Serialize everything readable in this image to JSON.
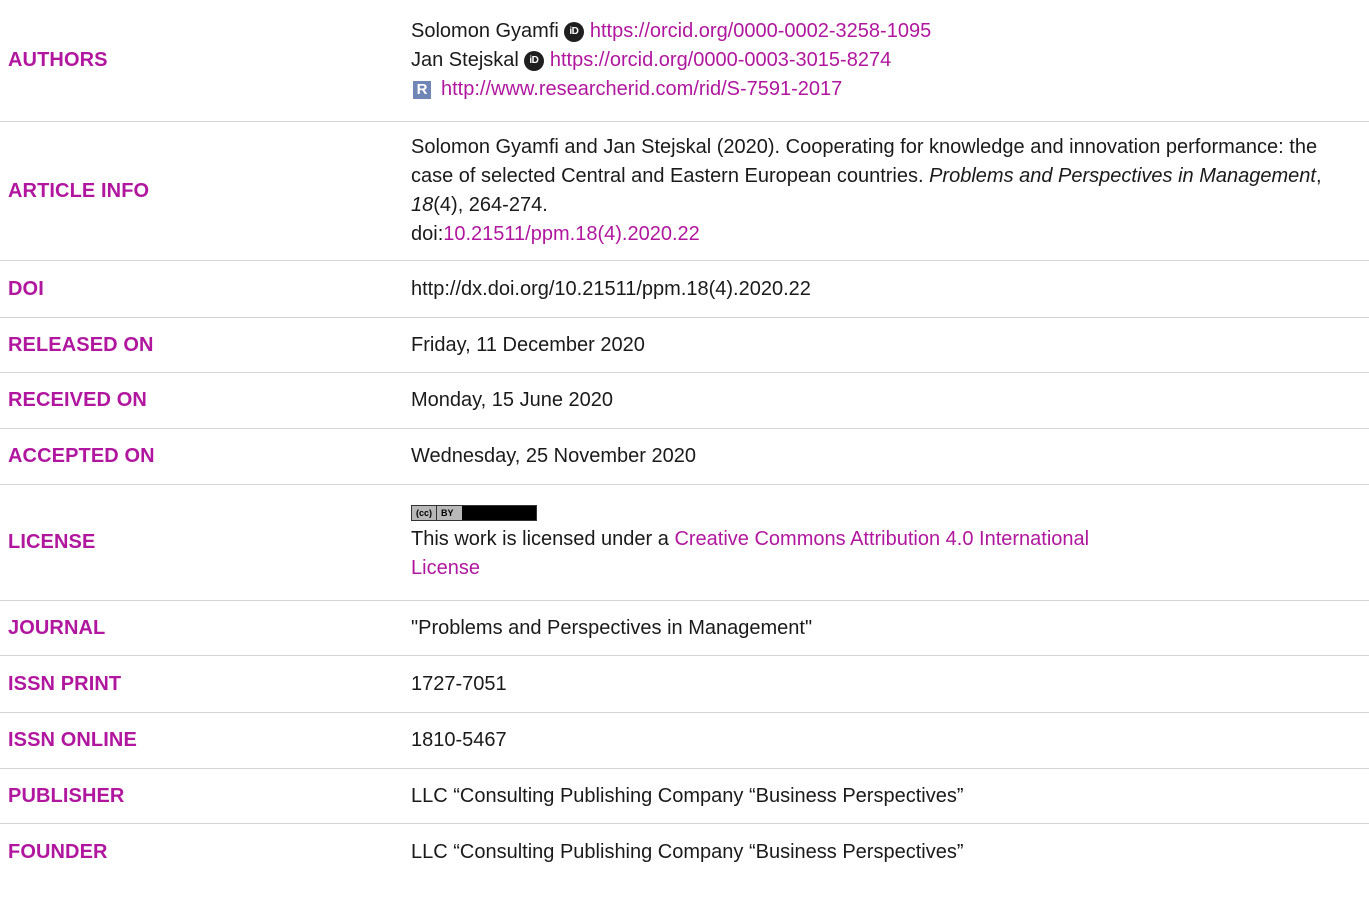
{
  "authors": {
    "label": "AUTHORS",
    "people": [
      {
        "name": "Solomon Gyamfi",
        "orcid_icon": "iD",
        "orcid_url": "https://orcid.org/0000-0002-3258-1095"
      },
      {
        "name": "Jan Stejskal",
        "orcid_icon": "iD",
        "orcid_url": "https://orcid.org/0000-0003-3015-8274"
      }
    ],
    "researcherid_icon": "R",
    "researcherid_url": "http://www.researcherid.com/rid/S-7591-2017"
  },
  "article_info": {
    "label": "ARTICLE INFO",
    "citation_lead": "Solomon Gyamfi and Jan Stejskal (2020). Cooperating for knowledge and innovation performance: the case of selected Central and Eastern European countries.",
    "journal_italic": "Problems and Perspectives in Management",
    "volume_italic": "18",
    "issue_pages": "(4), 264-274.",
    "doi_prefix": "doi:",
    "doi_link": "10.21511/ppm.18(4).2020.22"
  },
  "doi": {
    "label": "DOI",
    "value": "http://dx.doi.org/10.21511/ppm.18(4).2020.22"
  },
  "released_on": {
    "label": "RELEASED ON",
    "value": "Friday, 11 December 2020"
  },
  "received_on": {
    "label": "RECEIVED ON",
    "value": "Monday, 15 June 2020"
  },
  "accepted_on": {
    "label": "ACCEPTED ON",
    "value": "Wednesday, 25 November 2020"
  },
  "license": {
    "label": "LICENSE",
    "badge_cc": "(cc)",
    "badge_by": "BY",
    "text_lead": "This work is licensed under a",
    "link_text_line1": "Creative Commons Attribution 4.0 International",
    "link_text_line2": "License"
  },
  "journal": {
    "label": "JOURNAL",
    "value": "\"Problems and Perspectives in Management\""
  },
  "issn_print": {
    "label": "ISSN PRINT",
    "value": "1727-7051"
  },
  "issn_online": {
    "label": "ISSN ONLINE",
    "value": "1810-5467"
  },
  "publisher": {
    "label": "PUBLISHER",
    "value": "LLC “Consulting Publishing Company “Business Perspectives”"
  },
  "founder": {
    "label": "FOUNDER",
    "value": "LLC “Consulting Publishing Company “Business Perspectives”"
  },
  "colors": {
    "accent": "#b0179e",
    "text": "#1a1a1a",
    "divider": "#d4d4d4"
  }
}
